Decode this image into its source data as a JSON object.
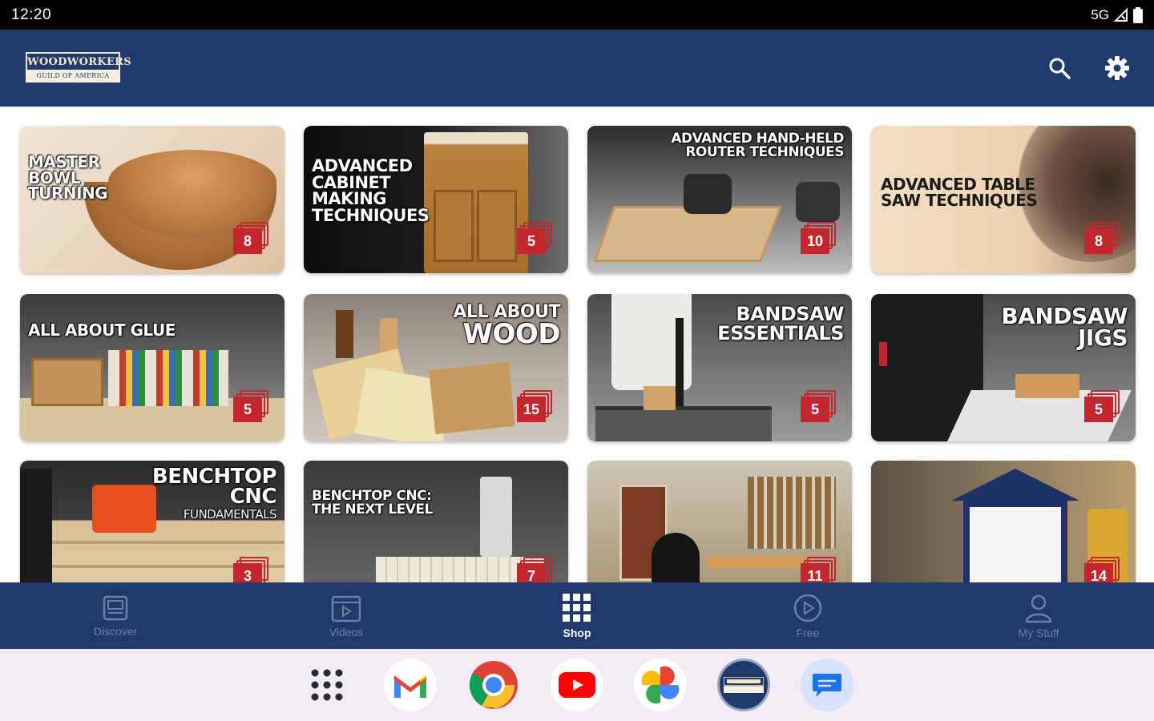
{
  "status_bar": {
    "time": "12:20",
    "network": "5G"
  },
  "app_bar": {
    "logo_top": "WOODWORKERS",
    "logo_bottom": "GUILD OF AMERICA"
  },
  "courses": [
    {
      "title": "MASTER BOWL TURNING",
      "count": "8"
    },
    {
      "title": "ADVANCED CABINET MAKING TECHNIQUES",
      "count": "5"
    },
    {
      "title": "ADVANCED HAND-HELD ROUTER TECHNIQUES",
      "count": "10"
    },
    {
      "title": "ADVANCED TABLE SAW TECHNIQUES",
      "count": "8"
    },
    {
      "title": "ALL ABOUT GLUE",
      "count": "5"
    },
    {
      "title_small": "ALL ABOUT",
      "title": "WOOD",
      "count": "15"
    },
    {
      "title": "BANDSAW ESSENTIALS",
      "count": "5"
    },
    {
      "title": "BANDSAW JIGS",
      "count": "5"
    },
    {
      "title": "BENCHTOP CNC",
      "title_sub": "FUNDAMENTALS",
      "count": "3"
    },
    {
      "title": "BENCHTOP CNC: THE NEXT LEVEL",
      "count": "7"
    },
    {
      "title": "",
      "count": "11"
    },
    {
      "title": "",
      "count": "14"
    }
  ],
  "bottom_nav": [
    {
      "label": "Discover",
      "icon": "discover-icon"
    },
    {
      "label": "Videos",
      "icon": "videos-icon"
    },
    {
      "label": "Shop",
      "icon": "shop-grid-icon",
      "active": true
    },
    {
      "label": "Free",
      "icon": "play-circle-icon"
    },
    {
      "label": "My Stuff",
      "icon": "person-icon"
    }
  ],
  "dock": [
    {
      "icon": "app-drawer-icon"
    },
    {
      "icon": "gmail-icon"
    },
    {
      "icon": "chrome-icon"
    },
    {
      "icon": "youtube-icon"
    },
    {
      "icon": "photos-icon"
    },
    {
      "icon": "woodworkers-app-icon"
    },
    {
      "icon": "messages-icon"
    }
  ],
  "colors": {
    "navy": "#213a6e",
    "badge_red": "#c4262e",
    "inactive_nav": "#6c7fa5"
  }
}
